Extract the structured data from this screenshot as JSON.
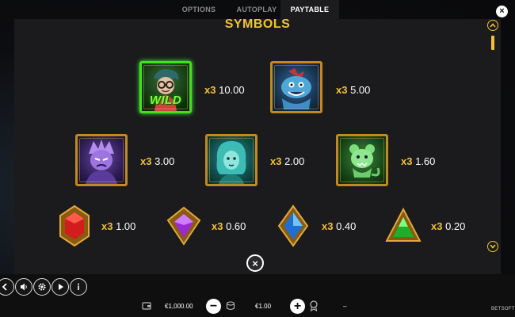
{
  "tabs": [
    {
      "label": "OPTIONS"
    },
    {
      "label": "AUTOPLAY"
    },
    {
      "label": "PAYTABLE",
      "active": true
    }
  ],
  "close_icon": "×",
  "title": "SYMBOLS",
  "symbols": [
    {
      "name": "wild",
      "icon": "wild-character-icon",
      "wild_text": "WILD",
      "mult": "x3",
      "value": "10.00"
    },
    {
      "name": "blue-ghost-dog",
      "icon": "blue-ghost-dog-icon",
      "mult": "x3",
      "value": "5.00"
    },
    {
      "name": "purple-ghost",
      "icon": "purple-ghost-icon",
      "mult": "x3",
      "value": "3.00"
    },
    {
      "name": "teal-ghost-woman",
      "icon": "teal-ghost-woman-icon",
      "mult": "x3",
      "value": "2.00"
    },
    {
      "name": "green-ghost-rat",
      "icon": "green-ghost-rat-icon",
      "mult": "x3",
      "value": "1.60"
    },
    {
      "name": "red-gem",
      "icon": "red-gem-icon",
      "mult": "x3",
      "value": "1.00"
    },
    {
      "name": "purple-gem",
      "icon": "purple-gem-icon",
      "mult": "x3",
      "value": "0.60"
    },
    {
      "name": "blue-gem",
      "icon": "blue-gem-icon",
      "mult": "x3",
      "value": "0.40"
    },
    {
      "name": "green-gem",
      "icon": "green-gem-icon",
      "mult": "x3",
      "value": "0.20"
    }
  ],
  "bottom_bar": {
    "balance": "€1,000.00",
    "bet": "€1.00",
    "win": "–",
    "minus": "−",
    "plus": "+",
    "brand": "BETSOFT"
  },
  "controls": [
    "back-icon",
    "sound-icon",
    "settings-icon",
    "play-icon",
    "info-icon"
  ],
  "colors": {
    "accent": "#f2c233",
    "panel": "#1b1b1d",
    "wild_green": "#7dff3a",
    "frame_gold": "#c28a1c"
  }
}
